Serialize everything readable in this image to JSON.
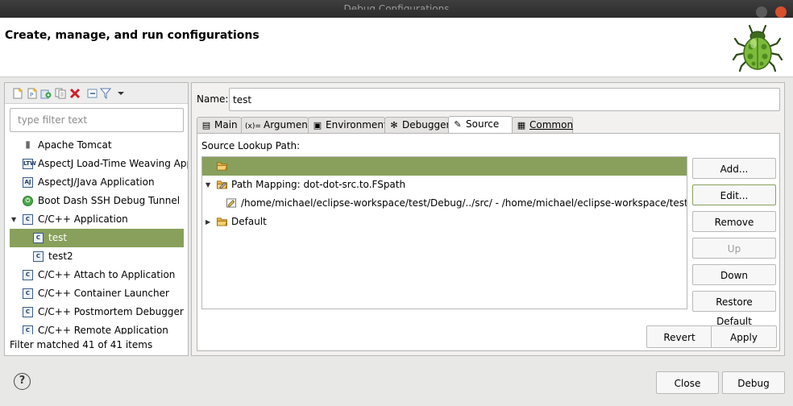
{
  "window": {
    "title": "Debug Configurations"
  },
  "header": {
    "title": "Create, manage, and run configurations"
  },
  "left": {
    "toolbar_icons": [
      "new-config-icon",
      "new-prototype-icon",
      "export-icon",
      "duplicate-icon",
      "delete-icon",
      "collapse-all-icon",
      "filter-icon",
      "view-menu-icon"
    ],
    "filter_placeholder": "type filter text",
    "tree": [
      {
        "label": "Apache Tomcat",
        "icon": "tomcat-icon",
        "glyph": "▮",
        "level": 0
      },
      {
        "label": "AspectJ Load-Time Weaving Appl",
        "icon": "ltw-icon",
        "glyph": "LTW",
        "level": 0
      },
      {
        "label": "AspectJ/Java Application",
        "icon": "aj-icon",
        "glyph": "AJ",
        "level": 0
      },
      {
        "label": "Boot Dash SSH Debug Tunnel",
        "icon": "boot-dash-icon",
        "glyph": "⏻",
        "level": 0
      },
      {
        "label": "C/C++ Application",
        "icon": "cpp-app-icon",
        "glyph": "C",
        "level": 0,
        "expanded": true
      },
      {
        "label": "test",
        "icon": "cpp-config-icon",
        "glyph": "C",
        "level": 1,
        "selected": true
      },
      {
        "label": "test2",
        "icon": "cpp-config-icon",
        "glyph": "C",
        "level": 1
      },
      {
        "label": "C/C++ Attach to Application",
        "icon": "cpp-attach-icon",
        "glyph": "C",
        "level": 0
      },
      {
        "label": "C/C++ Container Launcher",
        "icon": "cpp-container-icon",
        "glyph": "C",
        "level": 0
      },
      {
        "label": "C/C++ Postmortem Debugger",
        "icon": "cpp-postmortem-icon",
        "glyph": "C",
        "level": 0
      },
      {
        "label": "C/C++ Remote Application",
        "icon": "cpp-remote-icon",
        "glyph": "C",
        "level": 0
      }
    ],
    "status": "Filter matched 41 of 41 items"
  },
  "right": {
    "name_label": "Name:",
    "name_value": "test",
    "tabs": [
      {
        "label": "Main",
        "icon": "main-tab-icon",
        "glyph": "▤"
      },
      {
        "label": "Arguments",
        "icon": "arguments-tab-icon",
        "glyph": "(x)="
      },
      {
        "label": "Environment",
        "icon": "environment-tab-icon",
        "glyph": "▣"
      },
      {
        "label": "Debugger",
        "icon": "debugger-tab-icon",
        "glyph": "✻"
      },
      {
        "label": "Source",
        "icon": "source-tab-icon",
        "glyph": "✎",
        "active": true
      },
      {
        "label": "Common",
        "icon": "common-tab-icon",
        "glyph": "▦"
      }
    ],
    "source": {
      "label": "Source Lookup Path:",
      "rows": [
        {
          "label": "",
          "icon": "folder-open-icon",
          "level": 0,
          "selected": true
        },
        {
          "label": "Path Mapping: dot-dot-src.to.FSpath",
          "icon": "path-mapping-icon",
          "level": 0,
          "expanded": true
        },
        {
          "label": "/home/michael/eclipse-workspace/test/Debug/../src/ - /home/michael/eclipse-workspace/test/src",
          "icon": "mapping-entry-icon",
          "level": 1
        },
        {
          "label": "Default",
          "icon": "folder-icon",
          "level": 0,
          "collapsed": true
        }
      ],
      "buttons": [
        {
          "label": "Add...",
          "state": "normal"
        },
        {
          "label": "Edit...",
          "state": "focused"
        },
        {
          "label": "Remove",
          "state": "normal"
        },
        {
          "label": "Up",
          "state": "disabled"
        },
        {
          "label": "Down",
          "state": "normal"
        },
        {
          "label": "Restore Default",
          "state": "normal"
        }
      ]
    },
    "revert_label": "Revert",
    "apply_label": "Apply"
  },
  "footer": {
    "help_label": "?",
    "close_label": "Close",
    "debug_label": "Debug"
  }
}
